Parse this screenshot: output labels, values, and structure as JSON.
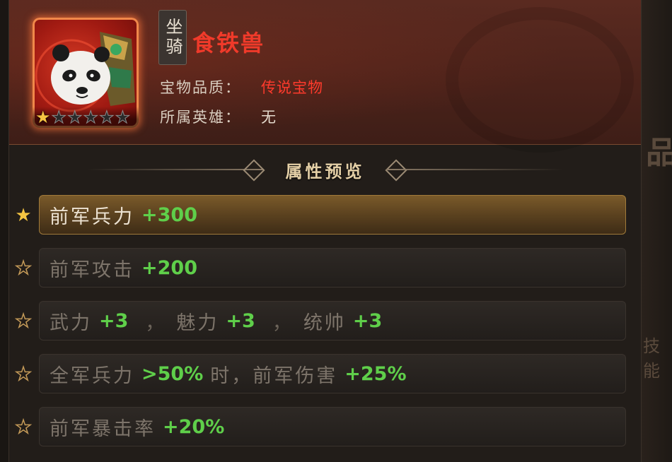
{
  "item": {
    "type_label": "坐骑",
    "name": "食铁兽",
    "quality_label": "宝物品质：",
    "quality_value": "传说宝物",
    "hero_label": "所属英雄：",
    "hero_value": "无",
    "stars_filled": 1,
    "stars_total": 6
  },
  "section": {
    "title": "属性预览"
  },
  "attributes": [
    {
      "unlocked": true,
      "parts": [
        "前军兵力",
        "+300"
      ]
    },
    {
      "unlocked": false,
      "parts": [
        "前军攻击",
        "+200"
      ]
    },
    {
      "unlocked": false,
      "parts": [
        "武力",
        "+3",
        "，",
        "魅力",
        "+3",
        "，",
        "统帅",
        "+3"
      ]
    },
    {
      "unlocked": false,
      "parts": [
        "全军兵力",
        ">50%",
        "时，前军伤害",
        "+25%"
      ]
    },
    {
      "unlocked": false,
      "parts": [
        "前军暴击率",
        "+20%"
      ]
    }
  ],
  "background_right": {
    "ghost_text_1": "品",
    "ghost_text_2": "技能"
  },
  "colors": {
    "name_red": "#f03a2a",
    "bonus_green": "#5fcf4a",
    "star_gold": "#f5c542",
    "active_row": "#7a5a2a"
  }
}
